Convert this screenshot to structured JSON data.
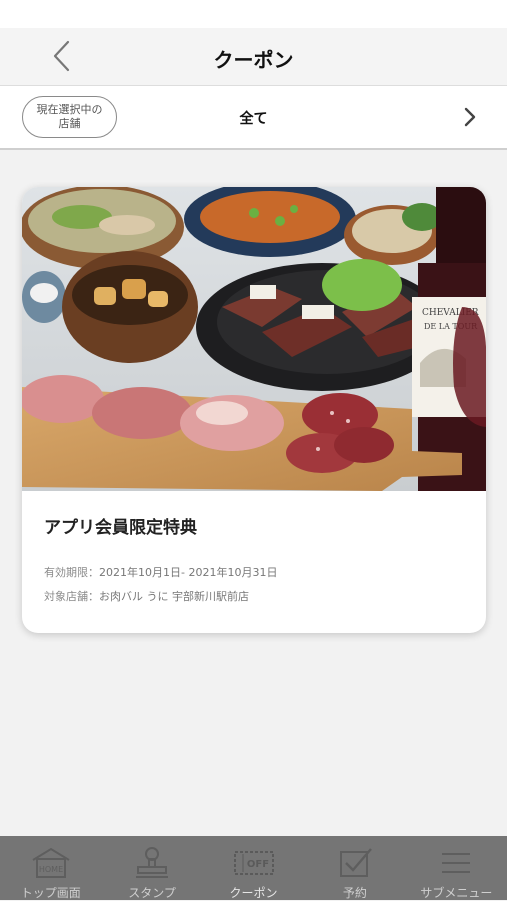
{
  "header": {
    "title": "クーポン"
  },
  "filter": {
    "store_button_line1": "現在選択中の",
    "store_button_line2": "店舗",
    "category_label": "全て"
  },
  "coupon": {
    "title": "アプリ会員限定特典",
    "validity_label": "有効期限：",
    "validity_value": "2021年10月1日- 2021年10月31日",
    "store_label": "対象店舗：",
    "store_value": "お肉バル うに 宇部新川駅前店",
    "bottle_label_1": "CHEVALIER",
    "bottle_label_2": "DE LA TOUR"
  },
  "tabbar": {
    "items": [
      {
        "label": "トップ画面",
        "icon": "home-icon",
        "icon_text": "HOME"
      },
      {
        "label": "スタンプ",
        "icon": "stamp-icon"
      },
      {
        "label": "クーポン",
        "icon": "coupon-off-icon",
        "icon_text": "OFF"
      },
      {
        "label": "予約",
        "icon": "reservation-check-icon"
      },
      {
        "label": "サブメニュー",
        "icon": "menu-icon"
      }
    ],
    "active_index": 2
  },
  "colors": {
    "tabbar_bg": "#757575",
    "tab_label": "#cfcfcf",
    "page_bg": "#f2f2f2"
  }
}
